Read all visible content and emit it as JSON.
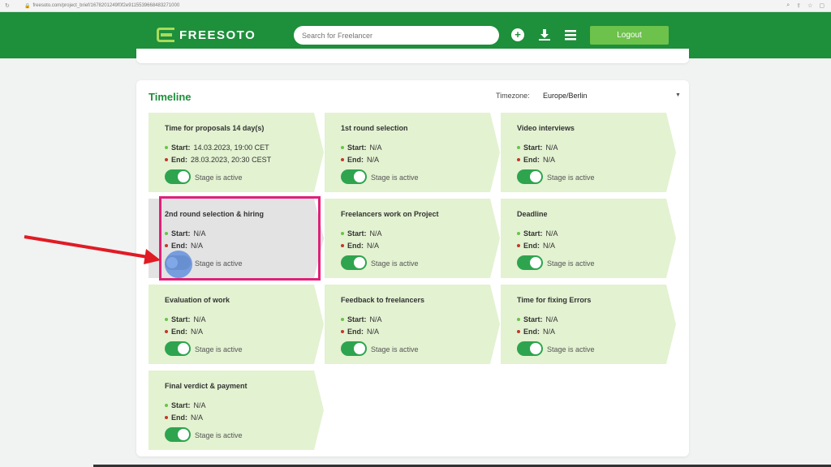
{
  "browser": {
    "url": "freesoto.com/project_brief/1678201249f0f2e9115539668483271000"
  },
  "header": {
    "brand": "FREESOTO",
    "search_placeholder": "Search for Freelancer",
    "logout_label": "Logout"
  },
  "timeline": {
    "title": "Timeline",
    "timezone_label": "Timezone:",
    "timezone_value": "Europe/Berlin",
    "start_label": "Start:",
    "end_label": "End:",
    "toggle_label": "Stage is active",
    "stages": [
      {
        "title": "Time for proposals 14 day(s)",
        "start": "14.03.2023, 19:00 CET",
        "end": "28.03.2023, 20:30 CEST",
        "active": true
      },
      {
        "title": "1st round selection",
        "start": "N/A",
        "end": "N/A",
        "active": true
      },
      {
        "title": "Video interviews",
        "start": "N/A",
        "end": "N/A",
        "active": true
      },
      {
        "title": "2nd round selection & hiring",
        "start": "N/A",
        "end": "N/A",
        "active": false
      },
      {
        "title": "Freelancers work on Project",
        "start": "N/A",
        "end": "N/A",
        "active": true
      },
      {
        "title": "Deadline",
        "start": "N/A",
        "end": "N/A",
        "active": true
      },
      {
        "title": "Evaluation of work",
        "start": "N/A",
        "end": "N/A",
        "active": true
      },
      {
        "title": "Feedback to freelancers",
        "start": "N/A",
        "end": "N/A",
        "active": true
      },
      {
        "title": "Time for fixing Errors",
        "start": "N/A",
        "end": "N/A",
        "active": true
      },
      {
        "title": "Final verdict & payment",
        "start": "N/A",
        "end": "N/A",
        "active": true
      }
    ]
  },
  "colors": {
    "brand_green": "#1e8f3b",
    "accent_green": "#6cc24a",
    "card_green": "#e3f2d1",
    "highlight": "#e0207a",
    "annotation_arrow": "#e01b24"
  }
}
